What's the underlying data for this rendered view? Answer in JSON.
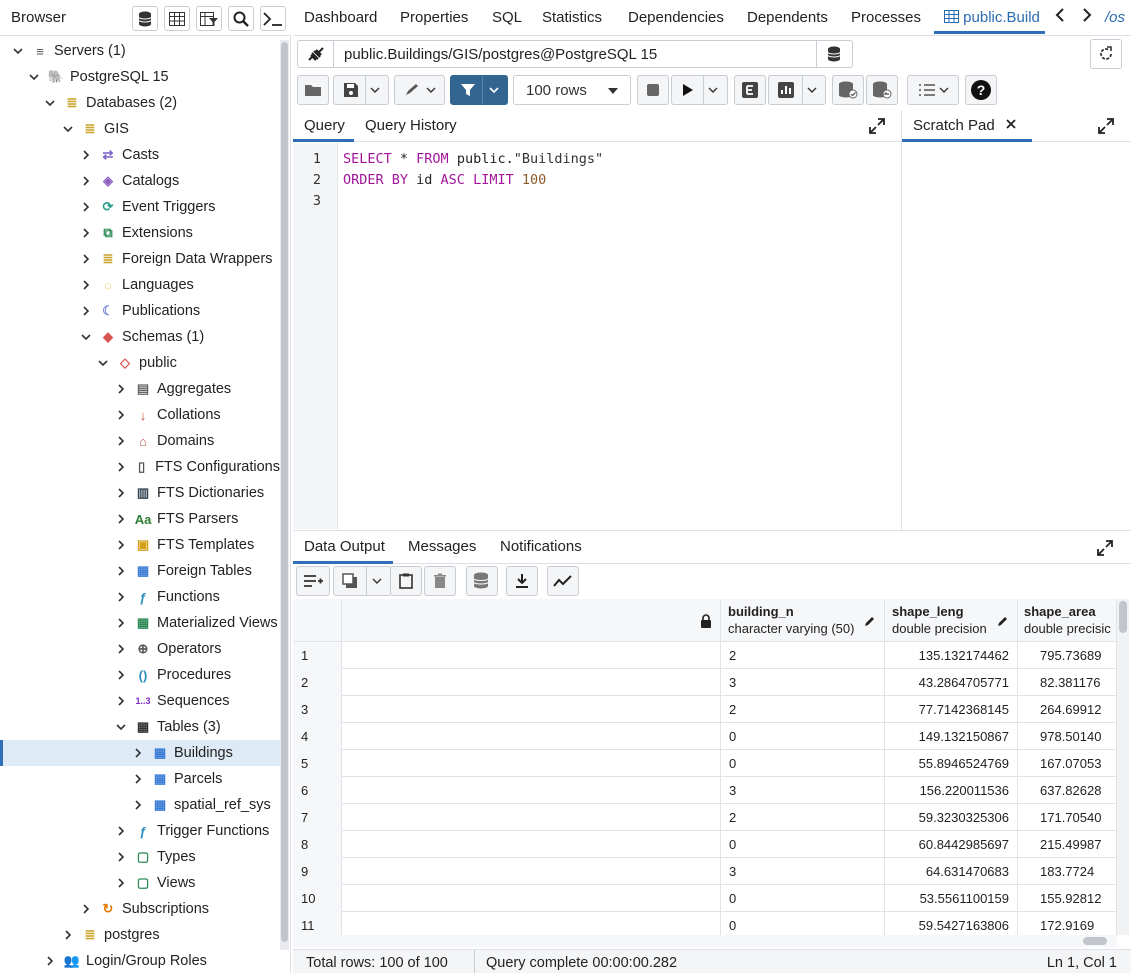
{
  "browser": {
    "title": "Browser",
    "tree": [
      {
        "label": "Servers (1)",
        "icon": "servers-icon",
        "depth": 0,
        "expanded": true
      },
      {
        "label": "PostgreSQL 15",
        "icon": "elephant-icon",
        "depth": 1,
        "expanded": true
      },
      {
        "label": "Databases (2)",
        "icon": "database-icon",
        "depth": 2,
        "expanded": true
      },
      {
        "label": "GIS",
        "icon": "database-icon",
        "depth": 3,
        "expanded": true
      },
      {
        "label": "Casts",
        "icon": "casts-icon",
        "depth": 4,
        "expanded": false
      },
      {
        "label": "Catalogs",
        "icon": "catalogs-icon",
        "depth": 4,
        "expanded": false
      },
      {
        "label": "Event Triggers",
        "icon": "event-triggers-icon",
        "depth": 4,
        "expanded": false
      },
      {
        "label": "Extensions",
        "icon": "extensions-icon",
        "depth": 4,
        "expanded": false
      },
      {
        "label": "Foreign Data Wrappers",
        "icon": "fdw-icon",
        "depth": 4,
        "expanded": false
      },
      {
        "label": "Languages",
        "icon": "languages-icon",
        "depth": 4,
        "expanded": false
      },
      {
        "label": "Publications",
        "icon": "publications-icon",
        "depth": 4,
        "expanded": false
      },
      {
        "label": "Schemas (1)",
        "icon": "schemas-icon",
        "depth": 4,
        "expanded": true
      },
      {
        "label": "public",
        "icon": "schema-icon",
        "depth": 5,
        "expanded": true
      },
      {
        "label": "Aggregates",
        "icon": "aggregates-icon",
        "depth": 6,
        "expanded": false
      },
      {
        "label": "Collations",
        "icon": "collations-icon",
        "depth": 6,
        "expanded": false
      },
      {
        "label": "Domains",
        "icon": "domains-icon",
        "depth": 6,
        "expanded": false
      },
      {
        "label": "FTS Configurations",
        "icon": "fts-config-icon",
        "depth": 6,
        "expanded": false
      },
      {
        "label": "FTS Dictionaries",
        "icon": "fts-dict-icon",
        "depth": 6,
        "expanded": false
      },
      {
        "label": "FTS Parsers",
        "icon": "fts-parser-icon",
        "depth": 6,
        "expanded": false
      },
      {
        "label": "FTS Templates",
        "icon": "fts-template-icon",
        "depth": 6,
        "expanded": false
      },
      {
        "label": "Foreign Tables",
        "icon": "foreign-tables-icon",
        "depth": 6,
        "expanded": false
      },
      {
        "label": "Functions",
        "icon": "functions-icon",
        "depth": 6,
        "expanded": false
      },
      {
        "label": "Materialized Views",
        "icon": "mat-views-icon",
        "depth": 6,
        "expanded": false
      },
      {
        "label": "Operators",
        "icon": "operators-icon",
        "depth": 6,
        "expanded": false
      },
      {
        "label": "Procedures",
        "icon": "procedures-icon",
        "depth": 6,
        "expanded": false
      },
      {
        "label": "Sequences",
        "icon": "sequences-icon",
        "depth": 6,
        "expanded": false
      },
      {
        "label": "Tables (3)",
        "icon": "tables-icon",
        "depth": 6,
        "expanded": true
      },
      {
        "label": "Buildings",
        "icon": "table-icon",
        "depth": 7,
        "expanded": false,
        "selected": true
      },
      {
        "label": "Parcels",
        "icon": "table-icon",
        "depth": 7,
        "expanded": false
      },
      {
        "label": "spatial_ref_sys",
        "icon": "table-icon",
        "depth": 7,
        "expanded": false
      },
      {
        "label": "Trigger Functions",
        "icon": "trigger-functions-icon",
        "depth": 6,
        "expanded": false
      },
      {
        "label": "Types",
        "icon": "types-icon",
        "depth": 6,
        "expanded": false
      },
      {
        "label": "Views",
        "icon": "views-icon",
        "depth": 6,
        "expanded": false
      },
      {
        "label": "Subscriptions",
        "icon": "subscriptions-icon",
        "depth": 4,
        "expanded": false
      },
      {
        "label": "postgres",
        "icon": "database-icon",
        "depth": 3,
        "expanded": false
      },
      {
        "label": "Login/Group Roles",
        "icon": "roles-icon",
        "depth": 2,
        "expanded": false
      }
    ]
  },
  "tabs": {
    "dashboard": "Dashboard",
    "properties": "Properties",
    "sql": "SQL",
    "statistics": "Statistics",
    "dependencies": "Dependencies",
    "dependents": "Dependents",
    "processes": "Processes",
    "active": "public.Build",
    "overflow": "/os"
  },
  "connection": "public.Buildings/GIS/postgres@PostgreSQL 15",
  "toolbar": {
    "rows_limit": "100 rows"
  },
  "query_tabs": {
    "query": "Query",
    "history": "Query History",
    "scratch": "Scratch Pad"
  },
  "editor": {
    "lines": [
      "1",
      "2",
      "3"
    ],
    "line1": {
      "kw1": "SELECT",
      "rest1": " * ",
      "kw2": "FROM",
      "rest2": " public.",
      "str": "\"Buildings\""
    },
    "line2": {
      "kw1": "ORDER BY",
      "rest1": " id ",
      "kw2": "ASC",
      "rest2": " ",
      "kw3": "LIMIT",
      "rest3": " ",
      "num": "100"
    }
  },
  "output_tabs": {
    "data": "Data Output",
    "messages": "Messages",
    "notifications": "Notifications"
  },
  "grid": {
    "columns": [
      {
        "name": "building_n",
        "type": "character varying (50)"
      },
      {
        "name": "shape_leng",
        "type": "double precision"
      },
      {
        "name": "shape_area",
        "type": "double precisic"
      }
    ],
    "rows": [
      {
        "n": "1",
        "b": "2",
        "l": "135.132174462",
        "a": "795.73689"
      },
      {
        "n": "2",
        "b": "3",
        "l": "43.2864705771",
        "a": "82.381176"
      },
      {
        "n": "3",
        "b": "2",
        "l": "77.7142368145",
        "a": "264.69912"
      },
      {
        "n": "4",
        "b": "0",
        "l": "149.132150867",
        "a": "978.50140"
      },
      {
        "n": "5",
        "b": "0",
        "l": "55.8946524769",
        "a": "167.07053"
      },
      {
        "n": "6",
        "b": "3",
        "l": "156.220011536",
        "a": "637.82628"
      },
      {
        "n": "7",
        "b": "2",
        "l": "59.3230325306",
        "a": "171.70540"
      },
      {
        "n": "8",
        "b": "0",
        "l": "60.8442985697",
        "a": "215.49987"
      },
      {
        "n": "9",
        "b": "3",
        "l": "64.631470683",
        "a": "183.7724"
      },
      {
        "n": "10",
        "b": "0",
        "l": "53.5561100159",
        "a": "155.92812"
      },
      {
        "n": "11",
        "b": "0",
        "l": "59.5427163806",
        "a": "172.9169"
      }
    ]
  },
  "status": {
    "rows": "Total rows: 100 of 100",
    "query": "Query complete 00:00:00.282",
    "pos": "Ln 1, Col 1"
  }
}
